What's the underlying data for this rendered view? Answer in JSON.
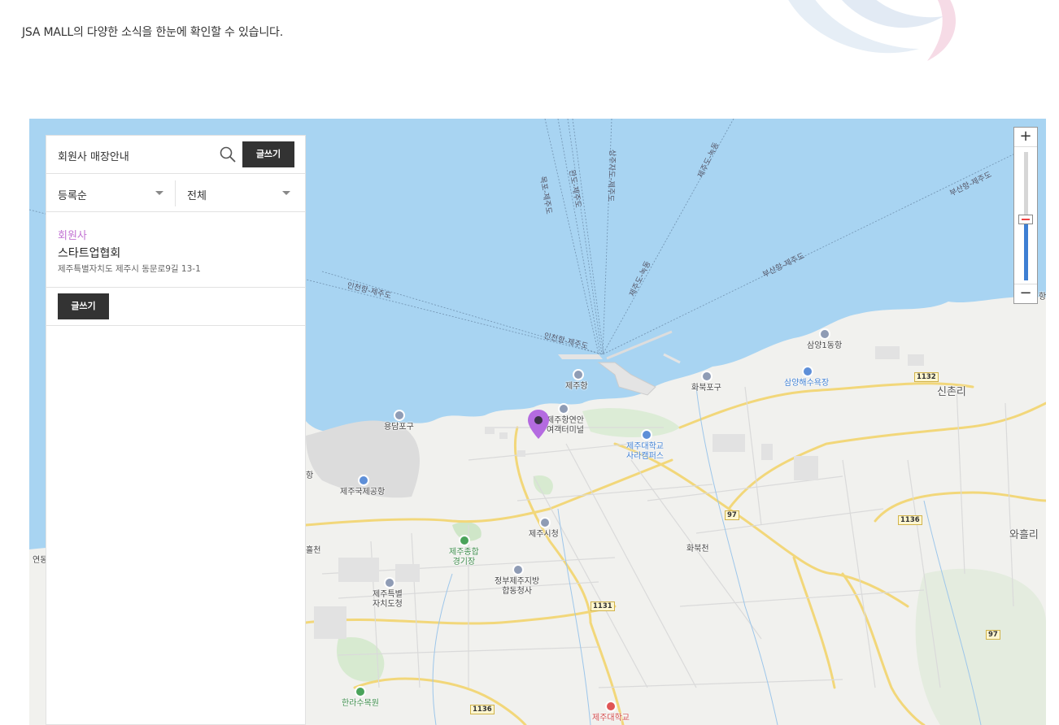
{
  "intro": "JSA MALL의 다양한 소식을 한눈에 확인할 수 있습니다.",
  "panel": {
    "search_title": "회원사 매장안내",
    "write_button": "글쓰기",
    "sort_select": "등록순",
    "filter_select": "전체",
    "item": {
      "category": "회원사",
      "name": "스타트업협회",
      "address": "제주특별자치도 제주시 동문로9길 13-1"
    },
    "write_button_bottom": "글쓰기"
  },
  "zoom": {
    "plus": "+",
    "minus": "−"
  },
  "map_labels": {
    "route_mokpo": "목포-제주도",
    "route_wando": "완도-제주도",
    "route_sangju": "상주자도-제주도",
    "route_jeju_nokdong": "제주도-녹동",
    "route_busan1": "부산항-제주도",
    "route_incheon1": "인천항-제주도",
    "route_jeju_nokdong2": "제주도-녹동",
    "route_busan2": "부산항-제주도",
    "route_incheon2": "인천항-제주도",
    "jeju_port": "제주항",
    "coastal_terminal": "제주항연안\n여객터미널",
    "yongdam": "용담포구",
    "airport": "제주국제공항",
    "hwabuk_port": "화북포구",
    "samyang1": "삼양1동항",
    "samyang_beach": "삼양해수욕장",
    "sinchon": "신촌리",
    "jnu_sara": "제주대학교\n사라캠퍼스",
    "cityhall": "제주시청",
    "stadium": "제주종합\n경기장",
    "govt": "정부제주지방\n합동청사",
    "provincial": "제주특별\n자치도청",
    "hwabukcheon": "화북천",
    "waheul": "와흘리",
    "arboretum": "한라수목원",
    "jnu": "제주대학교",
    "yeondong": "연동",
    "right_edge": "항",
    "west_stream": "흘천",
    "west_edge": "항",
    "r1132": "1132",
    "r97a": "97",
    "r1136a": "1136",
    "r1131": "1131",
    "r97b": "97",
    "r1136b": "1136"
  }
}
